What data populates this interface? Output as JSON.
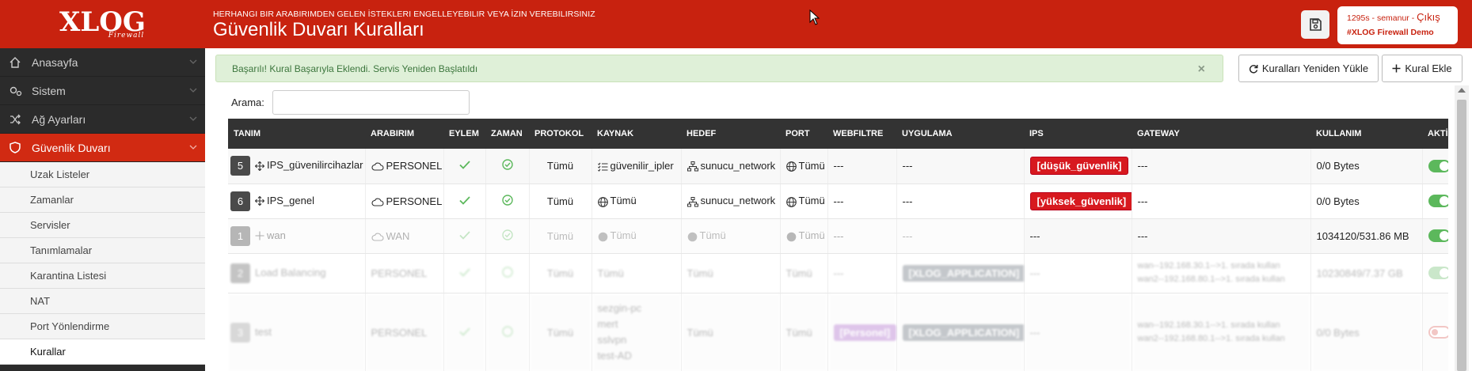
{
  "brand": {
    "logo_main": "XLOG",
    "logo_sub": "Firewall"
  },
  "header": {
    "subtitle": "HERHANGI BIR ARABIRIMDEN GELEN İSTEKLERI ENGELLEYEBILIR VEYA İZIN VEREBILIRSINIZ",
    "title": "Güvenlik Duvarı Kuralları"
  },
  "user": {
    "session": "1295s - semanur",
    "sep": " - ",
    "logout": "Çıkış",
    "org": "#XLOG Firewall Demo"
  },
  "sidebar": {
    "items": [
      {
        "label": "Anasayfa",
        "icon": "home-icon"
      },
      {
        "label": "Sistem",
        "icon": "cogs-icon"
      },
      {
        "label": "Ağ Ayarları",
        "icon": "shuffle-icon"
      },
      {
        "label": "Güvenlik Duvarı",
        "icon": "shield-icon",
        "active": true
      }
    ],
    "subitems": [
      "Uzak Listeler",
      "Zamanlar",
      "Servisler",
      "Tanımlamalar",
      "Karantina Listesi",
      "NAT",
      "Port Yönlendirme",
      "Kurallar"
    ]
  },
  "alert": {
    "message": "Başarılı! Kural Başarıyla Eklendi. Servis Yeniden Başlatıldı",
    "close": "×"
  },
  "toolbar": {
    "reload_label": "Kuralları Yeniden Yükle",
    "add_label": "Kural Ekle"
  },
  "search": {
    "label": "Arama:",
    "value": "",
    "placeholder": ""
  },
  "table": {
    "headers": [
      "TANIM",
      "ARABIRIM",
      "EYLEM",
      "ZAMAN",
      "PROTOKOL",
      "KAYNAK",
      "HEDEF",
      "PORT",
      "WEBFILTRE",
      "UYGULAMA",
      "IPS",
      "GATEWAY",
      "KULLANIM",
      "AKTİF"
    ],
    "rows": [
      {
        "num": "5",
        "name": "IPS_güvenilircihazlar",
        "iface": "PERSONEL",
        "protocol": "Tümü",
        "source": "güvenilir_ipler",
        "dest": "sunucu_network",
        "port": "Tümü",
        "webfilter": "---",
        "app": "---",
        "ips": "[düşük_güvenlik]",
        "gateway": "---",
        "usage": "0/0 Bytes"
      },
      {
        "num": "6",
        "name": "IPS_genel",
        "iface": "PERSONEL",
        "protocol": "Tümü",
        "source": "Tümü",
        "dest": "sunucu_network",
        "port": "Tümü",
        "webfilter": "---",
        "app": "---",
        "ips": "[yüksek_güvenlik]",
        "gateway": "---",
        "usage": "0/0 Bytes"
      },
      {
        "num": "1",
        "name": "wan",
        "iface": "WAN",
        "protocol": "Tümü",
        "source": "Tümü",
        "dest": "Tümü",
        "port": "Tümü",
        "webfilter": "---",
        "app": "---",
        "ips": "---",
        "gateway": "---",
        "usage": "1034120/531.86 MB"
      },
      {
        "num": "2",
        "name": "Load Balancing",
        "iface": "PERSONEL",
        "protocol": "Tümü",
        "source": "Tümü",
        "dest": "Tümü",
        "port": "Tümü",
        "webfilter": "---",
        "app": "[XLOG_APPLICATION]",
        "ips": "---",
        "gateway1": "wan--192.168.30.1-->1. sırada kullan",
        "gateway2": "wan2--192.168.80.1-->1. sırada kullan",
        "usage": "10230849/7.37 GB"
      },
      {
        "num": "3",
        "name": "test",
        "iface": "PERSONEL",
        "protocol": "Tümü",
        "sources": [
          "sezgin-pc",
          "mert",
          "sslvpn",
          "test-AD"
        ],
        "dest": "Tümü",
        "port": "Tümü",
        "webfilter": "[Personel]",
        "app": "[XLOG_APPLICATION]",
        "ips": "---",
        "gateway1": "wan--192.168.30.1-->1. sırada kullan",
        "gateway2": "wan2--192.168.80.1-->1. sırada kullan",
        "usage": "0/0 Bytes"
      }
    ]
  },
  "colors": {
    "brand_red": "#c8220f",
    "sidebar_dark": "#2b2b2b",
    "success_bg": "#dff0d8",
    "badge_red": "#d7191f",
    "toggle_green": "#5cb85c"
  }
}
